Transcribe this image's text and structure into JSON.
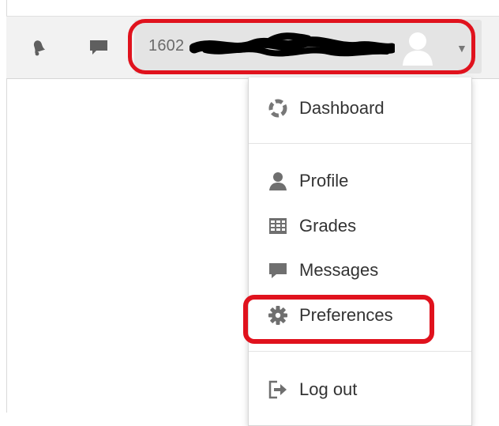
{
  "navbar": {
    "notifications_icon": "bell-icon",
    "messages_icon": "chat-bubble-icon",
    "user": {
      "username_prefix": "1602",
      "avatar_icon": "user-avatar-icon",
      "caret_icon": "caret-down-icon"
    }
  },
  "dropdown": {
    "items": [
      {
        "label": "Dashboard",
        "icon": "dashboard-icon"
      },
      {
        "label": "Profile",
        "icon": "user-icon"
      },
      {
        "label": "Grades",
        "icon": "grades-table-icon"
      },
      {
        "label": "Messages",
        "icon": "message-bubble-icon"
      },
      {
        "label": "Preferences",
        "icon": "gear-icon"
      },
      {
        "label": "Log out",
        "icon": "logout-icon"
      }
    ]
  },
  "colors": {
    "annotation": "#e0121d",
    "navbar_bg": "#f2f2f2",
    "user_toggle_bg": "#e4e4e4",
    "icon_gray": "#5f5f5f"
  }
}
